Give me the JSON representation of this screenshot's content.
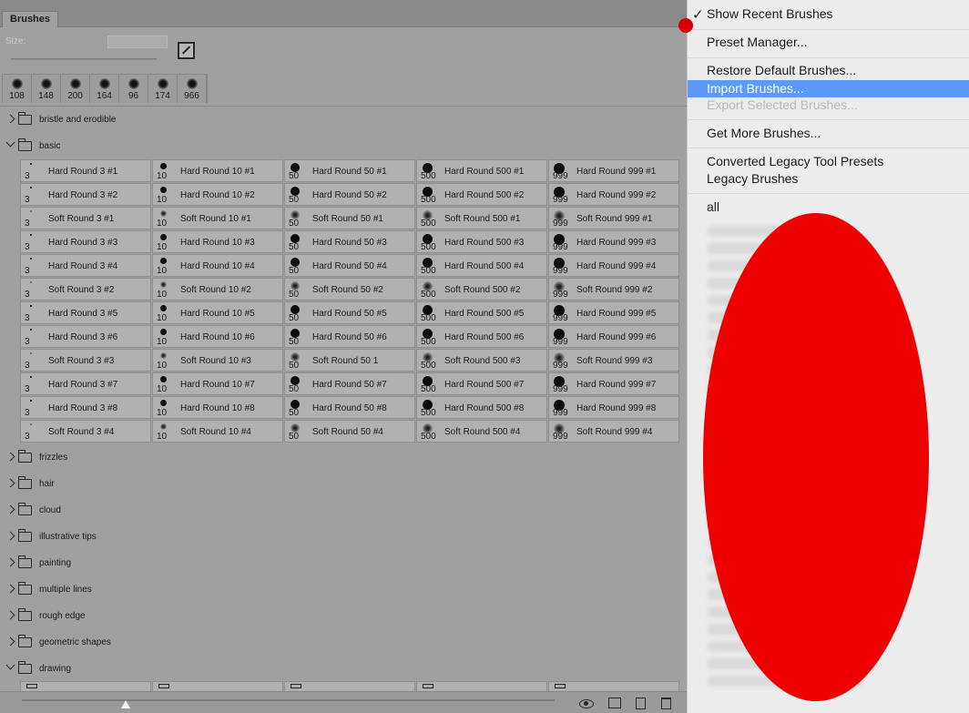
{
  "panel": {
    "tab_label": "Brushes",
    "size_label": "Size:",
    "size_value": "",
    "recent_brushes": [
      "108",
      "148",
      "200",
      "164",
      "96",
      "174",
      "966"
    ],
    "groups_top": [
      {
        "name": "bristle and erodible",
        "open": false
      },
      {
        "name": "basic",
        "open": true
      }
    ],
    "basic_columns": [
      {
        "size": "3",
        "items": [
          "Hard Round 3 #1",
          "Hard Round 3 #2",
          "Soft Round 3 #1",
          "Hard Round 3 #3",
          "Hard Round 3 #4",
          "Soft Round 3 #2",
          "Hard Round 3 #5",
          "Hard Round 3 #6",
          "Soft Round 3 #3",
          "Hard Round 3 #7",
          "Hard Round 3 #8",
          "Soft Round 3 #4"
        ]
      },
      {
        "size": "10",
        "items": [
          "Hard Round 10 #1",
          "Hard Round 10 #2",
          "Soft Round 10 #1",
          "Hard Round 10 #3",
          "Hard Round 10 #4",
          "Soft Round 10 #2",
          "Hard Round 10 #5",
          "Hard Round 10 #6",
          "Soft Round 10 #3",
          "Hard Round 10 #7",
          "Hard Round 10 #8",
          "Soft Round 10 #4"
        ]
      },
      {
        "size": "50",
        "items": [
          "Hard Round 50 #1",
          "Hard Round 50 #2",
          "Soft Round 50 #1",
          "Hard Round 50 #3",
          "Hard Round 50 #4",
          "Soft Round 50 #2",
          "Hard Round 50 #5",
          "Hard Round 50 #6",
          "Soft Round 50 1",
          "Hard Round 50 #7",
          "Hard Round 50 #8",
          "Soft Round 50 #4"
        ]
      },
      {
        "size": "500",
        "items": [
          "Hard Round 500 #1",
          "Hard Round 500 #2",
          "Soft Round 500 #1",
          "Hard Round 500 #3",
          "Hard Round 500 #4",
          "Soft Round 500 #2",
          "Hard Round 500 #5",
          "Hard Round 500 #6",
          "Soft Round 500 #3",
          "Hard Round 500 #7",
          "Hard Round 500 #8",
          "Soft Round 500 #4"
        ]
      },
      {
        "size": "999",
        "items": [
          "Hard Round 999 #1",
          "Hard Round 999 #2",
          "Soft Round 999 #1",
          "Hard Round 999 #3",
          "Hard Round 999 #4",
          "Soft Round 999 #2",
          "Hard Round 999 #5",
          "Hard Round 999 #6",
          "Soft Round 999 #3",
          "Hard Round 999 #7",
          "Hard Round 999 #8",
          "Soft Round 999 #4"
        ]
      }
    ],
    "groups_bottom": [
      {
        "name": "frizzles",
        "open": false
      },
      {
        "name": "hair",
        "open": false
      },
      {
        "name": "cloud",
        "open": false
      },
      {
        "name": "illustrative tips",
        "open": false
      },
      {
        "name": "painting",
        "open": false
      },
      {
        "name": "multiple lines",
        "open": false
      },
      {
        "name": "rough edge",
        "open": false
      },
      {
        "name": "geometric shapes",
        "open": false
      },
      {
        "name": "drawing",
        "open": true
      }
    ]
  },
  "menu": {
    "show_recent": "Show Recent Brushes",
    "show_recent_checked": true,
    "preset_manager": "Preset Manager...",
    "restore_defaults": "Restore Default Brushes...",
    "import_brushes": "Import Brushes...",
    "export_selected": "Export Selected Brushes...",
    "get_more": "Get More Brushes...",
    "converted_legacy": "Converted Legacy Tool Presets",
    "legacy_brushes": "Legacy Brushes",
    "all": "all",
    "highlight_color": "#5b9bf7",
    "redaction_color": "#ee0000"
  }
}
